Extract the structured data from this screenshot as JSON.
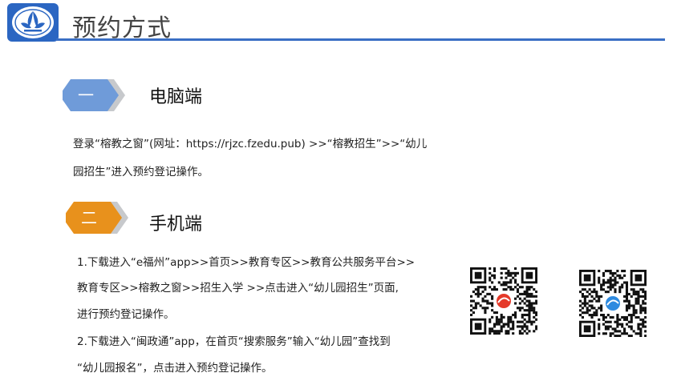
{
  "title": "预约方式",
  "section1": {
    "number": "一",
    "heading": "电脑端",
    "lines": [
      "登录“榕教之窗”(网址：https://rjzc.fzedu.pub) >>“榕教招生”>>“幼儿",
      "园招生”进入预约登记操作。"
    ]
  },
  "section2": {
    "number": "二",
    "heading": "手机端",
    "lines": [
      "1.下载进入“e福州”app>>首页>>教育专区>>教育公共服务平台>>",
      "教育专区>>榕教之窗>>招生入学   >>点击进入“幼儿园招生”页面,",
      "进行预约登记操作。",
      "2.下载进入“闽政通”app，在首页“搜索服务”输入“幼儿园”查找到",
      "“幼儿园报名”，点击进入预约登记操作。"
    ]
  },
  "colors": {
    "accent_blue": "#3a6fc4",
    "badge_blue": "#6f9bd9",
    "badge_orange": "#e8911c",
    "qr1_logo": "#e53a2a",
    "qr2_logo": "#2f8be0"
  },
  "icons": {
    "logo": "kindergarten-logo",
    "qr_efuzhou": "qr-code-e-fuzhou",
    "qr_minzhengtong": "qr-code-minzhengtong"
  }
}
